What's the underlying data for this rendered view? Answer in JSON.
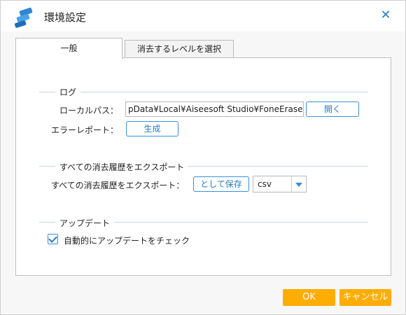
{
  "window": {
    "title": "環境設定"
  },
  "tabs": [
    {
      "label": "一般",
      "active": true
    },
    {
      "label": "消去するレベルを選択",
      "active": false
    }
  ],
  "log": {
    "section_title": "ログ",
    "local_path_label": "ローカルパス：",
    "local_path_value": "pData¥Local¥Aiseesoft Studio¥FoneEraser",
    "open_button": "開く",
    "error_report_label": "エラーレポート：",
    "generate_button": "生成"
  },
  "export": {
    "section_title": "すべての消去履歴をエクスポート",
    "label": "すべての消去履歴をエクスポート：",
    "save_as_button": "として保存",
    "format_selected": "csv"
  },
  "update": {
    "section_title": "アップデート",
    "auto_check_label": "自動的にアップデートをチェック",
    "auto_check_checked": true
  },
  "footer": {
    "ok": "OK",
    "cancel": "キャンセル"
  },
  "colors": {
    "accent": "#2b7cc0",
    "button_orange": "#ffad00",
    "line": "#c9d5e6"
  }
}
